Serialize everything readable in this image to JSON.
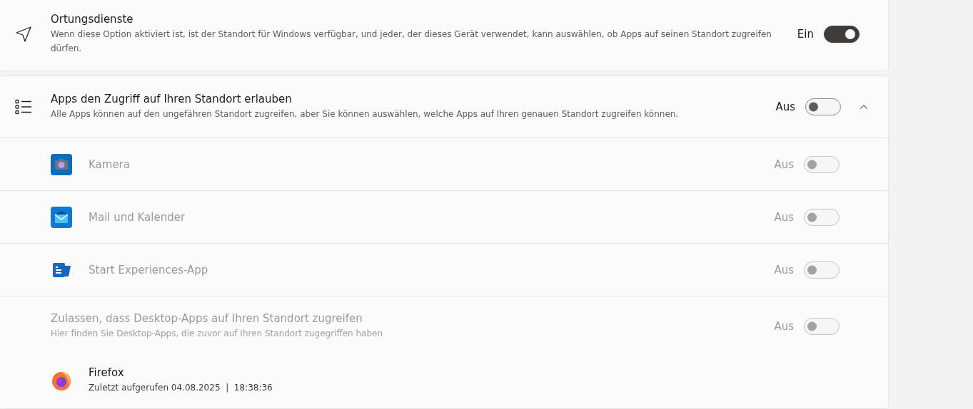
{
  "location_services": {
    "title": "Ortungsdienste",
    "description": "Wenn diese Option aktiviert ist, ist der Standort für Windows verfügbar, und jeder, der dieses Gerät verwendet, kann auswählen, ob Apps auf seinen Standort zugreifen dürfen.",
    "state_label": "Ein",
    "on": true
  },
  "app_access": {
    "title": "Apps den Zugriff auf Ihren Standort erlauben",
    "description": "Alle Apps können auf den ungefähren Standort zugreifen, aber Sie können auswählen, welche Apps auf Ihren genauen Standort zugreifen können.",
    "state_label": "Aus",
    "on": false,
    "expanded": true,
    "apps": [
      {
        "kind": "camera",
        "name": "Kamera",
        "state_label": "Aus",
        "on": false,
        "disabled": true
      },
      {
        "kind": "mail",
        "name": "Mail und Kalender",
        "state_label": "Aus",
        "on": false,
        "disabled": true
      },
      {
        "kind": "start",
        "name": "Start Experiences-App",
        "state_label": "Aus",
        "on": false,
        "disabled": true
      }
    ],
    "desktop_apps": {
      "title": "Zulassen, dass Desktop-Apps auf Ihren Standort zugreifen",
      "description": "Hier finden Sie Desktop-Apps, die zuvor auf Ihren Standort zugegriffen haben",
      "state_label": "Aus",
      "on": false,
      "disabled": true,
      "apps": [
        {
          "kind": "firefox",
          "name": "Firefox",
          "last_access": "Zuletzt aufgerufen 04.08.2025  |  18:38:36"
        }
      ]
    }
  }
}
